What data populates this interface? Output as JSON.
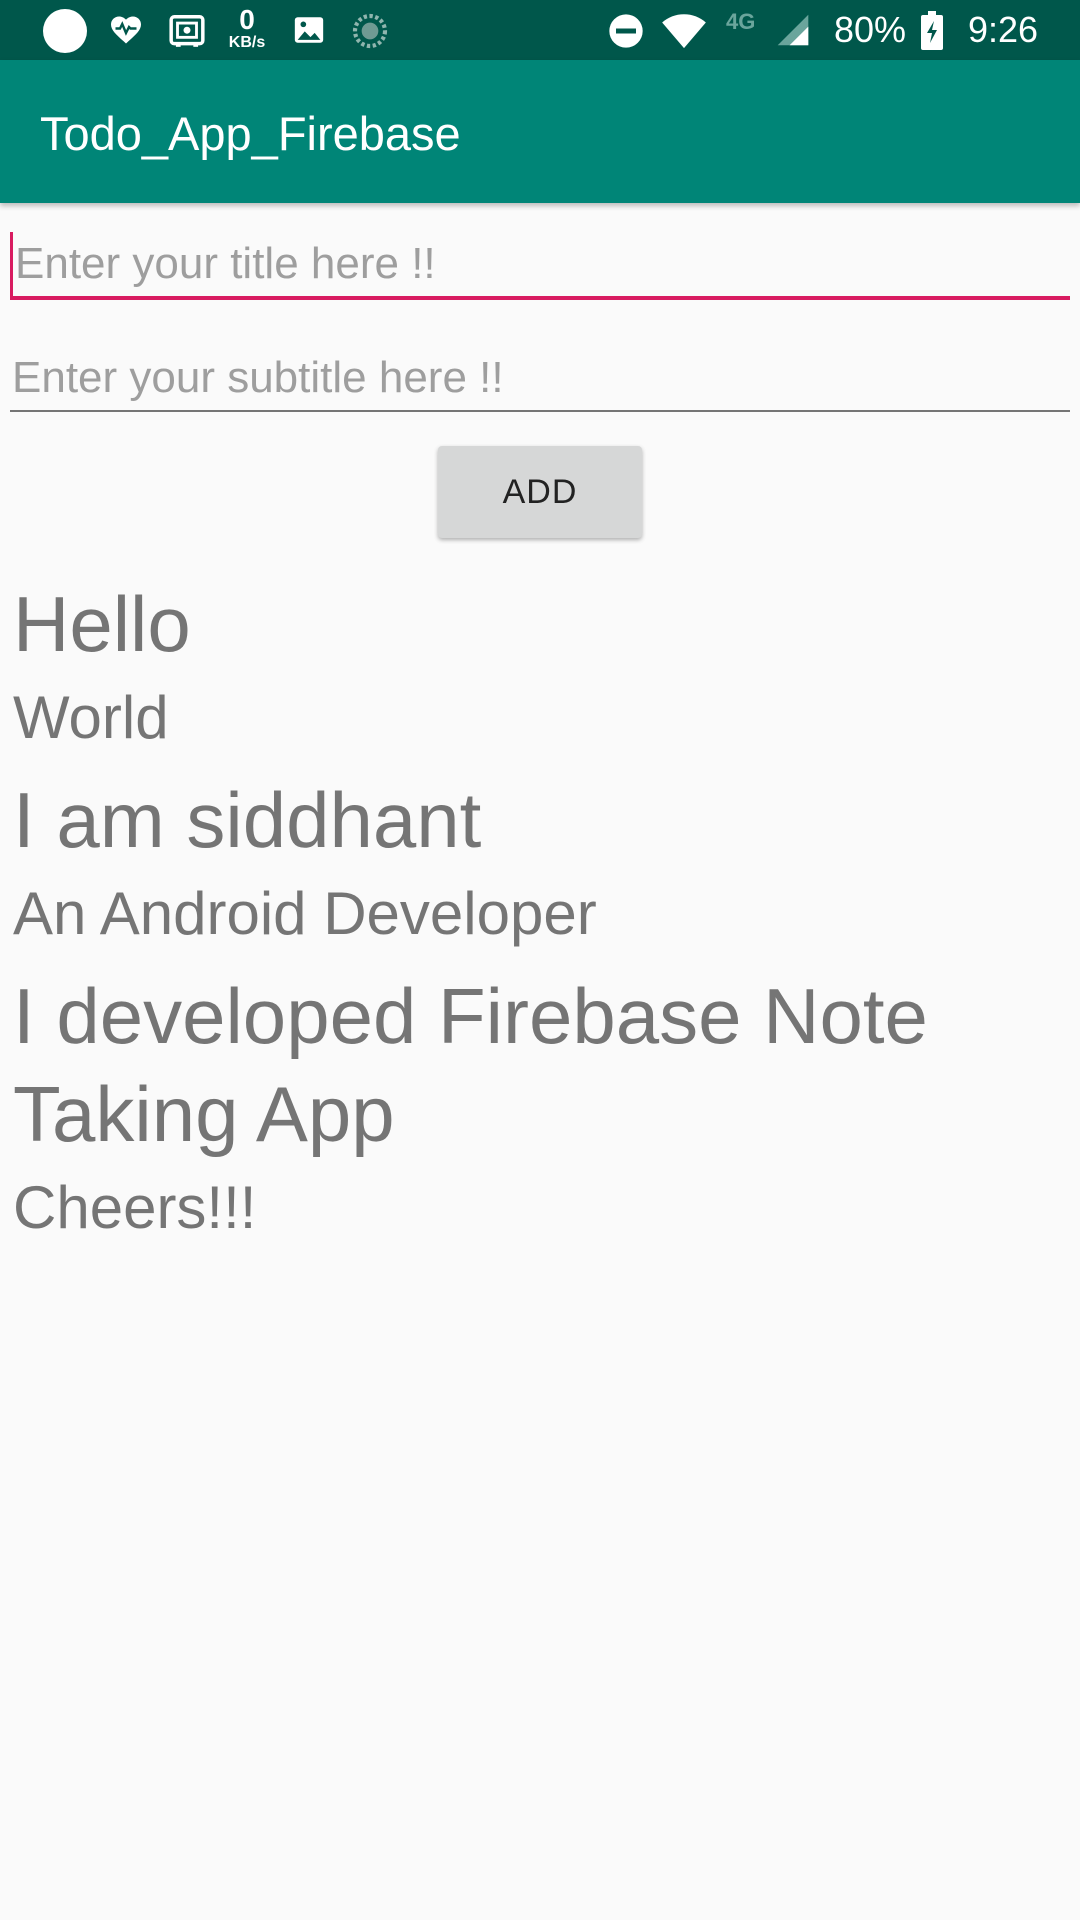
{
  "status_bar": {
    "speed_value": "0",
    "speed_unit": "KB/s",
    "network_type": "4G",
    "battery": "80%",
    "time": "9:26",
    "icons": [
      "circle-icon",
      "heart-pulse-icon",
      "safe-icon",
      "image-icon",
      "sync-icon",
      "do-not-disturb-icon",
      "wifi-icon",
      "signal-icon",
      "battery-charging-icon"
    ]
  },
  "app_bar": {
    "title": "Todo_App_Firebase"
  },
  "form": {
    "title_placeholder": "Enter your title here !!",
    "title_value": "",
    "subtitle_placeholder": "Enter your subtitle here !!",
    "subtitle_value": "",
    "add_label": "ADD"
  },
  "notes": [
    {
      "title": "Hello",
      "subtitle": "World"
    },
    {
      "title": "I am siddhant",
      "subtitle": "An Android Developer"
    },
    {
      "title": "I developed Firebase Note Taking App",
      "subtitle": "Cheers!!!"
    }
  ],
  "colors": {
    "status_bar": "#00574b",
    "app_bar": "#008577",
    "accent": "#d81b60",
    "background": "#fafafa",
    "note_text": "#757575"
  }
}
